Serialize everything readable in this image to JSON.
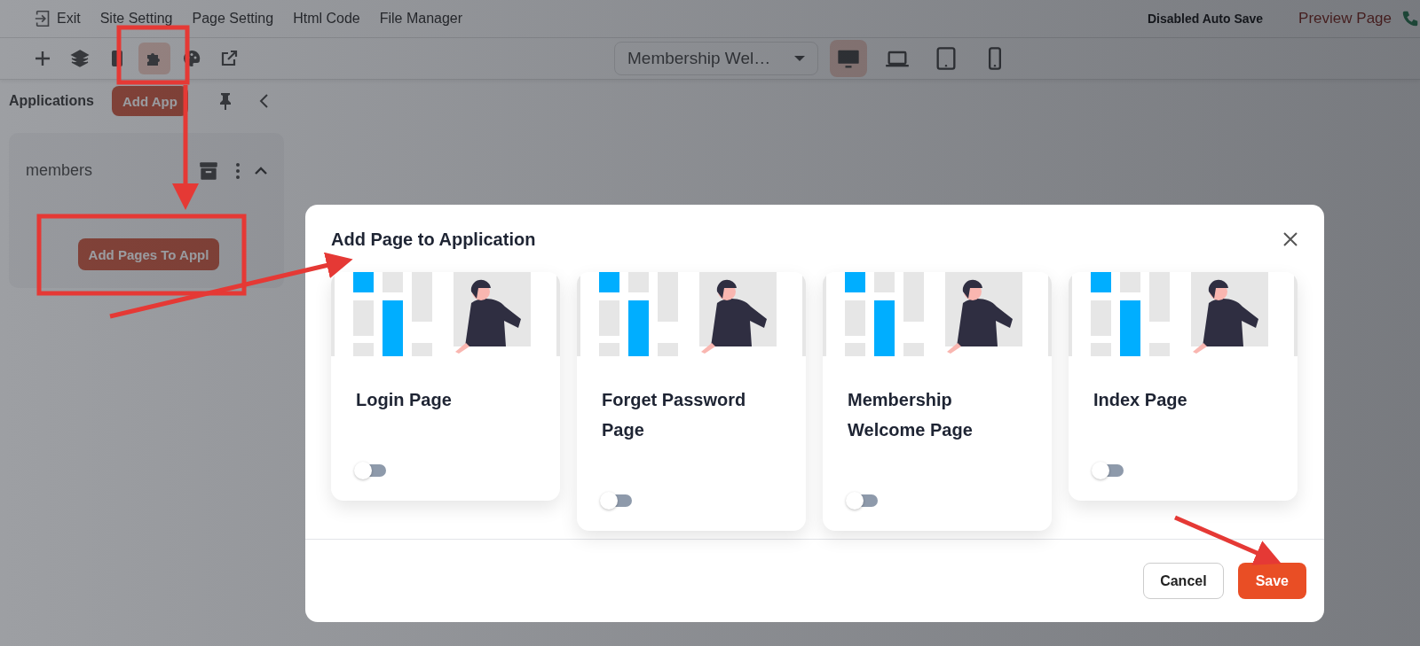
{
  "menu_bar": {
    "items": [
      {
        "kind": "exit",
        "label": "Exit"
      },
      {
        "kind": "text",
        "label": "Site Setting"
      },
      {
        "kind": "text",
        "label": "Page Setting"
      },
      {
        "kind": "text",
        "label": "Html Code"
      },
      {
        "kind": "text",
        "label": "File Manager"
      }
    ],
    "auto_save": "Disabled Auto Save",
    "preview": "Preview Page"
  },
  "toolbar": {
    "tools": [
      {
        "kind": "plus",
        "selected": false
      },
      {
        "kind": "layers",
        "selected": false
      },
      {
        "kind": "page",
        "selected": false
      },
      {
        "kind": "puzzle",
        "selected": true
      },
      {
        "kind": "palette",
        "selected": false
      },
      {
        "kind": "external",
        "selected": false
      }
    ],
    "page_select": "Membership Wel…",
    "devices": [
      {
        "kind": "desktop",
        "selected": true
      },
      {
        "kind": "laptop",
        "selected": false
      },
      {
        "kind": "tablet",
        "selected": false
      },
      {
        "kind": "phone",
        "selected": false
      }
    ]
  },
  "sidebar": {
    "title": "Applications",
    "add_button": "Add App",
    "apps": [
      {
        "name": "members",
        "expanded": true,
        "button": "Add Pages To Appl"
      }
    ]
  },
  "dialog": {
    "title": "Add Page to Application",
    "pages": [
      {
        "title": "Login Page",
        "on": false
      },
      {
        "title": "Forget Password Page",
        "on": false
      },
      {
        "title": "Membership Welcome Page",
        "on": false
      },
      {
        "title": "Index Page",
        "on": false
      }
    ],
    "buttons": [
      {
        "kind": "secondary",
        "label": "Cancel"
      },
      {
        "kind": "primary",
        "label": "Save"
      }
    ]
  }
}
